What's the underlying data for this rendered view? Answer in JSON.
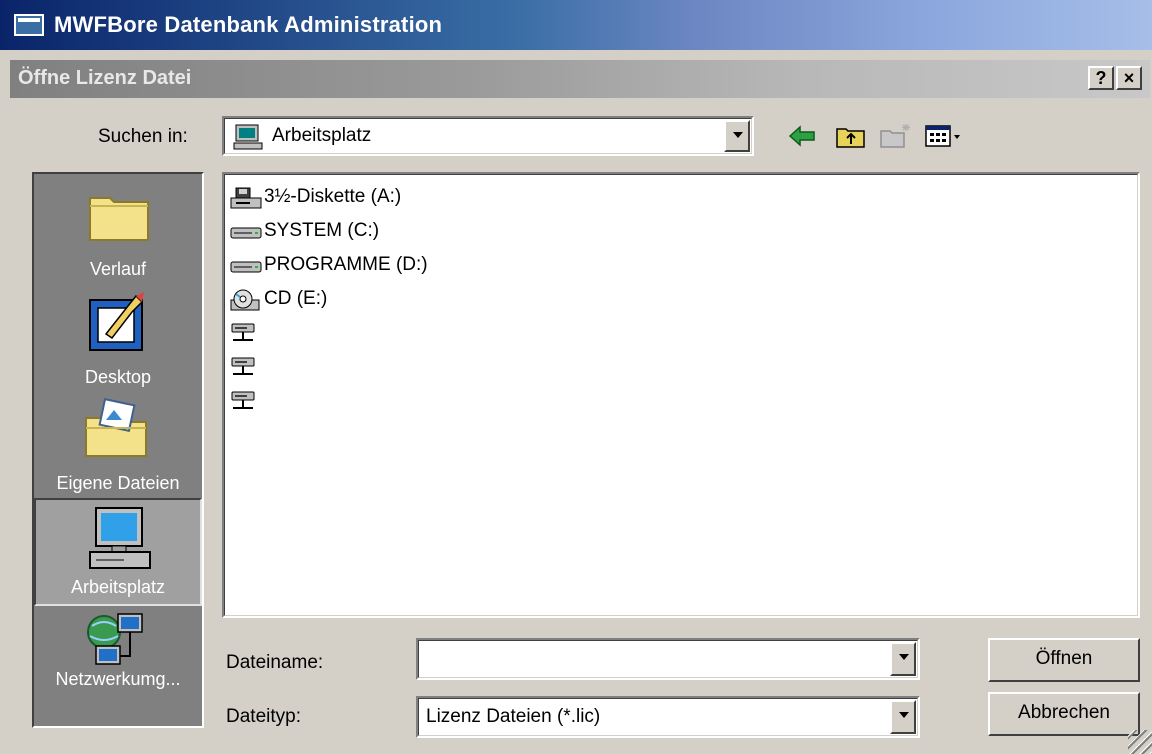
{
  "app": {
    "title": "MWFBore Datenbank Administration"
  },
  "dialog": {
    "title": "Öffne Lizenz Datei",
    "help_button": "?",
    "close_button": "×"
  },
  "look_in": {
    "label": "Suchen in:",
    "value": "Arbeitsplatz"
  },
  "toolbar": {
    "back_icon": "back-arrow-icon",
    "up_icon": "up-folder-icon",
    "new_folder_icon": "new-folder-icon",
    "view_icon": "view-menu-icon"
  },
  "places": [
    {
      "label": "Verlauf",
      "icon": "history-folder-icon"
    },
    {
      "label": "Desktop",
      "icon": "desktop-icon"
    },
    {
      "label": "Eigene Dateien",
      "icon": "my-documents-icon"
    },
    {
      "label": "Arbeitsplatz",
      "icon": "my-computer-icon",
      "selected": true
    },
    {
      "label": "Netzwerkumg...",
      "icon": "network-icon"
    }
  ],
  "files": [
    {
      "label": "3½-Diskette (A:)",
      "icon": "floppy-drive-icon"
    },
    {
      "label": "SYSTEM (C:)",
      "icon": "hard-drive-icon"
    },
    {
      "label": "PROGRAMME (D:)",
      "icon": "hard-drive-icon"
    },
    {
      "label": "CD (E:)",
      "icon": "cd-drive-icon"
    },
    {
      "label": "",
      "icon": "network-drive-icon"
    },
    {
      "label": "",
      "icon": "network-drive-icon"
    },
    {
      "label": "",
      "icon": "network-drive-icon"
    }
  ],
  "filename": {
    "label": "Dateiname:",
    "value": ""
  },
  "filetype": {
    "label": "Dateityp:",
    "value": "Lizenz Dateien (*.lic)"
  },
  "buttons": {
    "open": "Öffnen",
    "cancel": "Abbrechen"
  }
}
